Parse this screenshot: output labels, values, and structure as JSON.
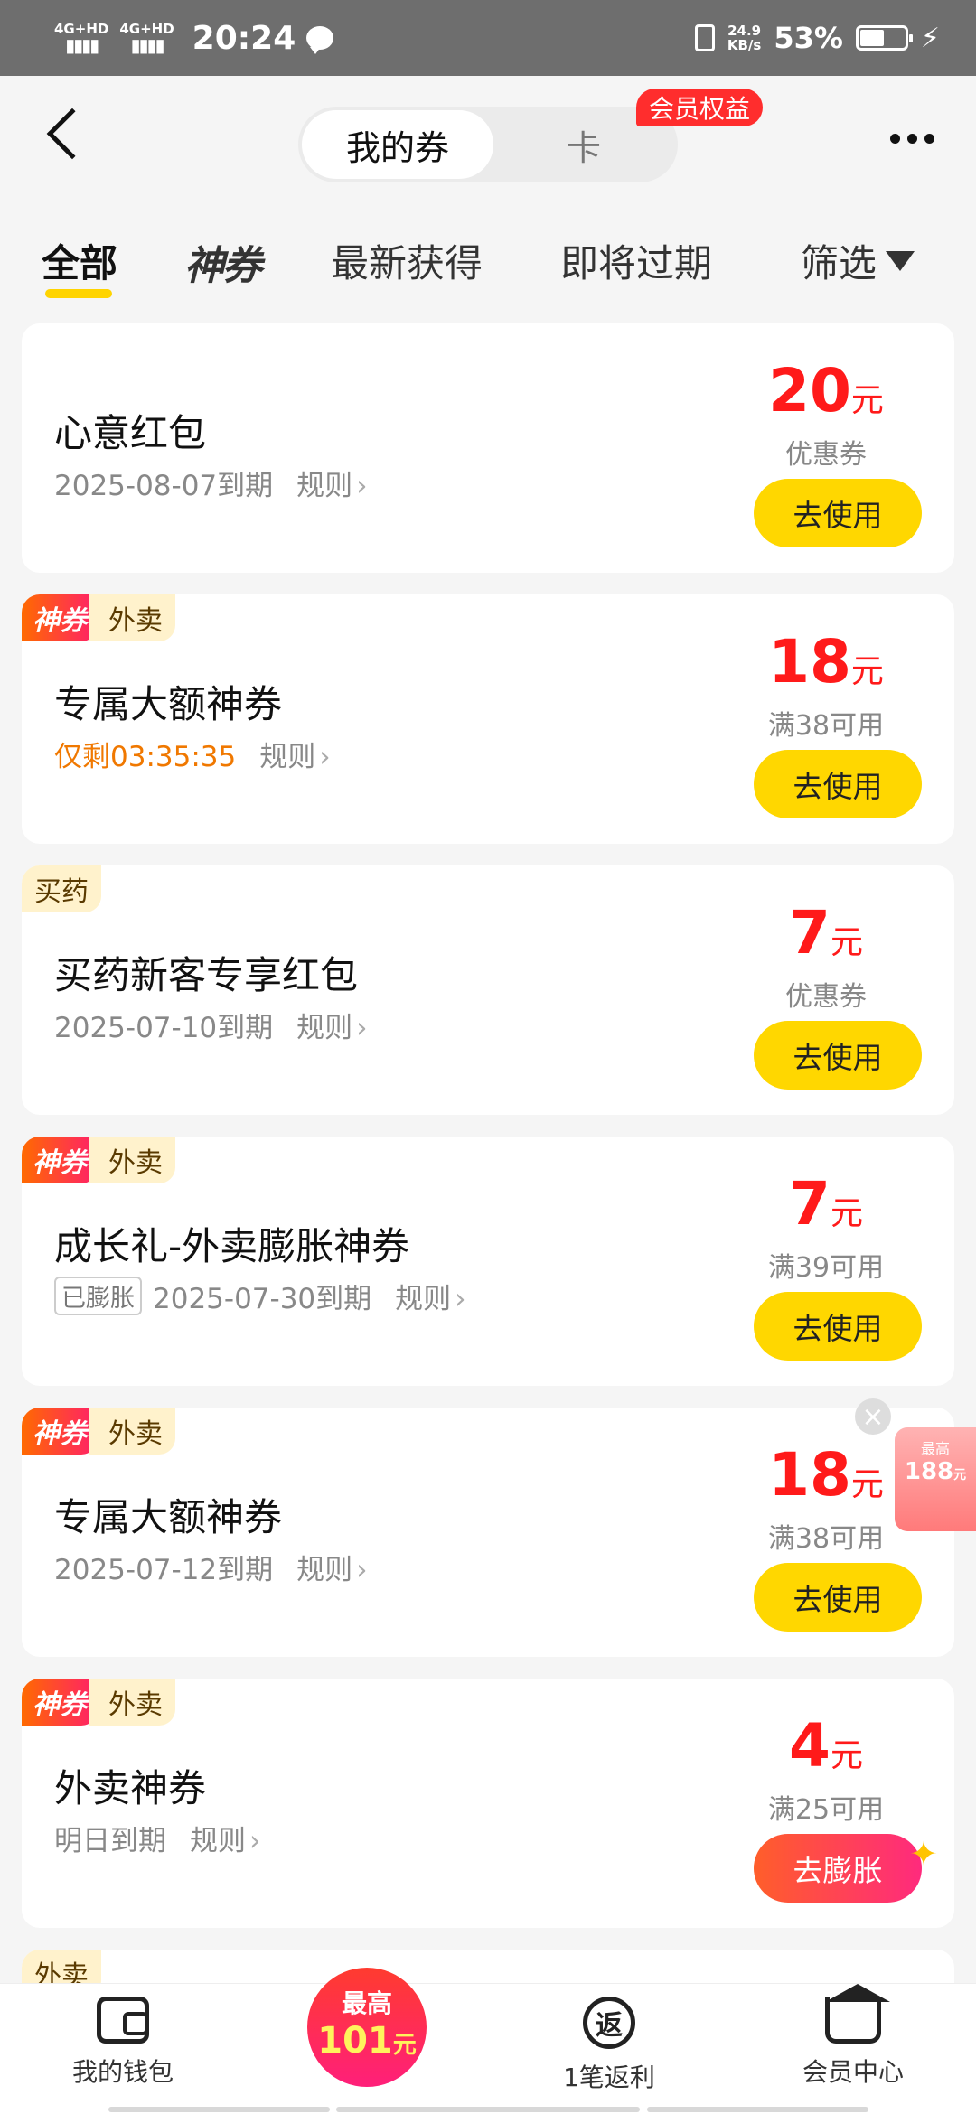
{
  "status_bar": {
    "sim1": "4G+HD",
    "sim2": "4G+HD",
    "time": "20:24",
    "net_speed_value": "24.9",
    "net_speed_unit": "KB/s",
    "battery": "53%"
  },
  "header": {
    "segment_active": "我的券",
    "segment_card": "卡",
    "vip_badge": "会员权益"
  },
  "tabs": {
    "all": "全部",
    "shen": "神券",
    "latest": "最新获得",
    "expiring": "即将过期",
    "filter": "筛选"
  },
  "coupons": [
    {
      "tag_shen": "",
      "tag_cat": "",
      "title": "心意红包",
      "meta": "2025-08-07到期",
      "rules": "规则",
      "amount": "20",
      "unit": "元",
      "sub": "优惠券",
      "button": "去使用"
    },
    {
      "tag_shen": "神券",
      "tag_cat": "外卖",
      "title": "专属大额神券",
      "meta": "仅剩03:35:35",
      "rules": "规则",
      "amount": "18",
      "unit": "元",
      "sub": "满38可用",
      "button": "去使用"
    },
    {
      "tag_shen": "",
      "tag_cat": "买药",
      "title": "买药新客专享红包",
      "meta": "2025-07-10到期",
      "rules": "规则",
      "amount": "7",
      "unit": "元",
      "sub": "优惠券",
      "button": "去使用"
    },
    {
      "tag_shen": "神券",
      "tag_cat": "外卖",
      "title": "成长礼-外卖膨胀神券",
      "inflated": "已膨胀",
      "meta": "2025-07-30到期",
      "rules": "规则",
      "amount": "7",
      "unit": "元",
      "sub": "满39可用",
      "button": "去使用"
    },
    {
      "tag_shen": "神券",
      "tag_cat": "外卖",
      "title": "专属大额神券",
      "meta": "2025-07-12到期",
      "rules": "规则",
      "amount": "18",
      "unit": "元",
      "sub": "满38可用",
      "button": "去使用"
    },
    {
      "tag_shen": "神券",
      "tag_cat": "外卖",
      "title": "外卖神券",
      "meta": "明日到期",
      "rules": "规则",
      "amount": "4",
      "unit": "元",
      "sub": "满25可用",
      "button": "去膨胀"
    },
    {
      "tag_shen": "",
      "tag_cat": "外卖",
      "title": "",
      "meta": "",
      "rules": "",
      "amount": "",
      "unit": "",
      "sub": "",
      "button": ""
    }
  ],
  "float_widget": {
    "label": "最高",
    "value": "188",
    "unit": "元"
  },
  "bottom_nav": {
    "wallet": "我的钱包",
    "promo_top": "最高",
    "promo_value": "101",
    "promo_unit": "元",
    "fanli_icon_char": "返",
    "fanli": "1笔返利",
    "vip_center": "会员中心"
  }
}
